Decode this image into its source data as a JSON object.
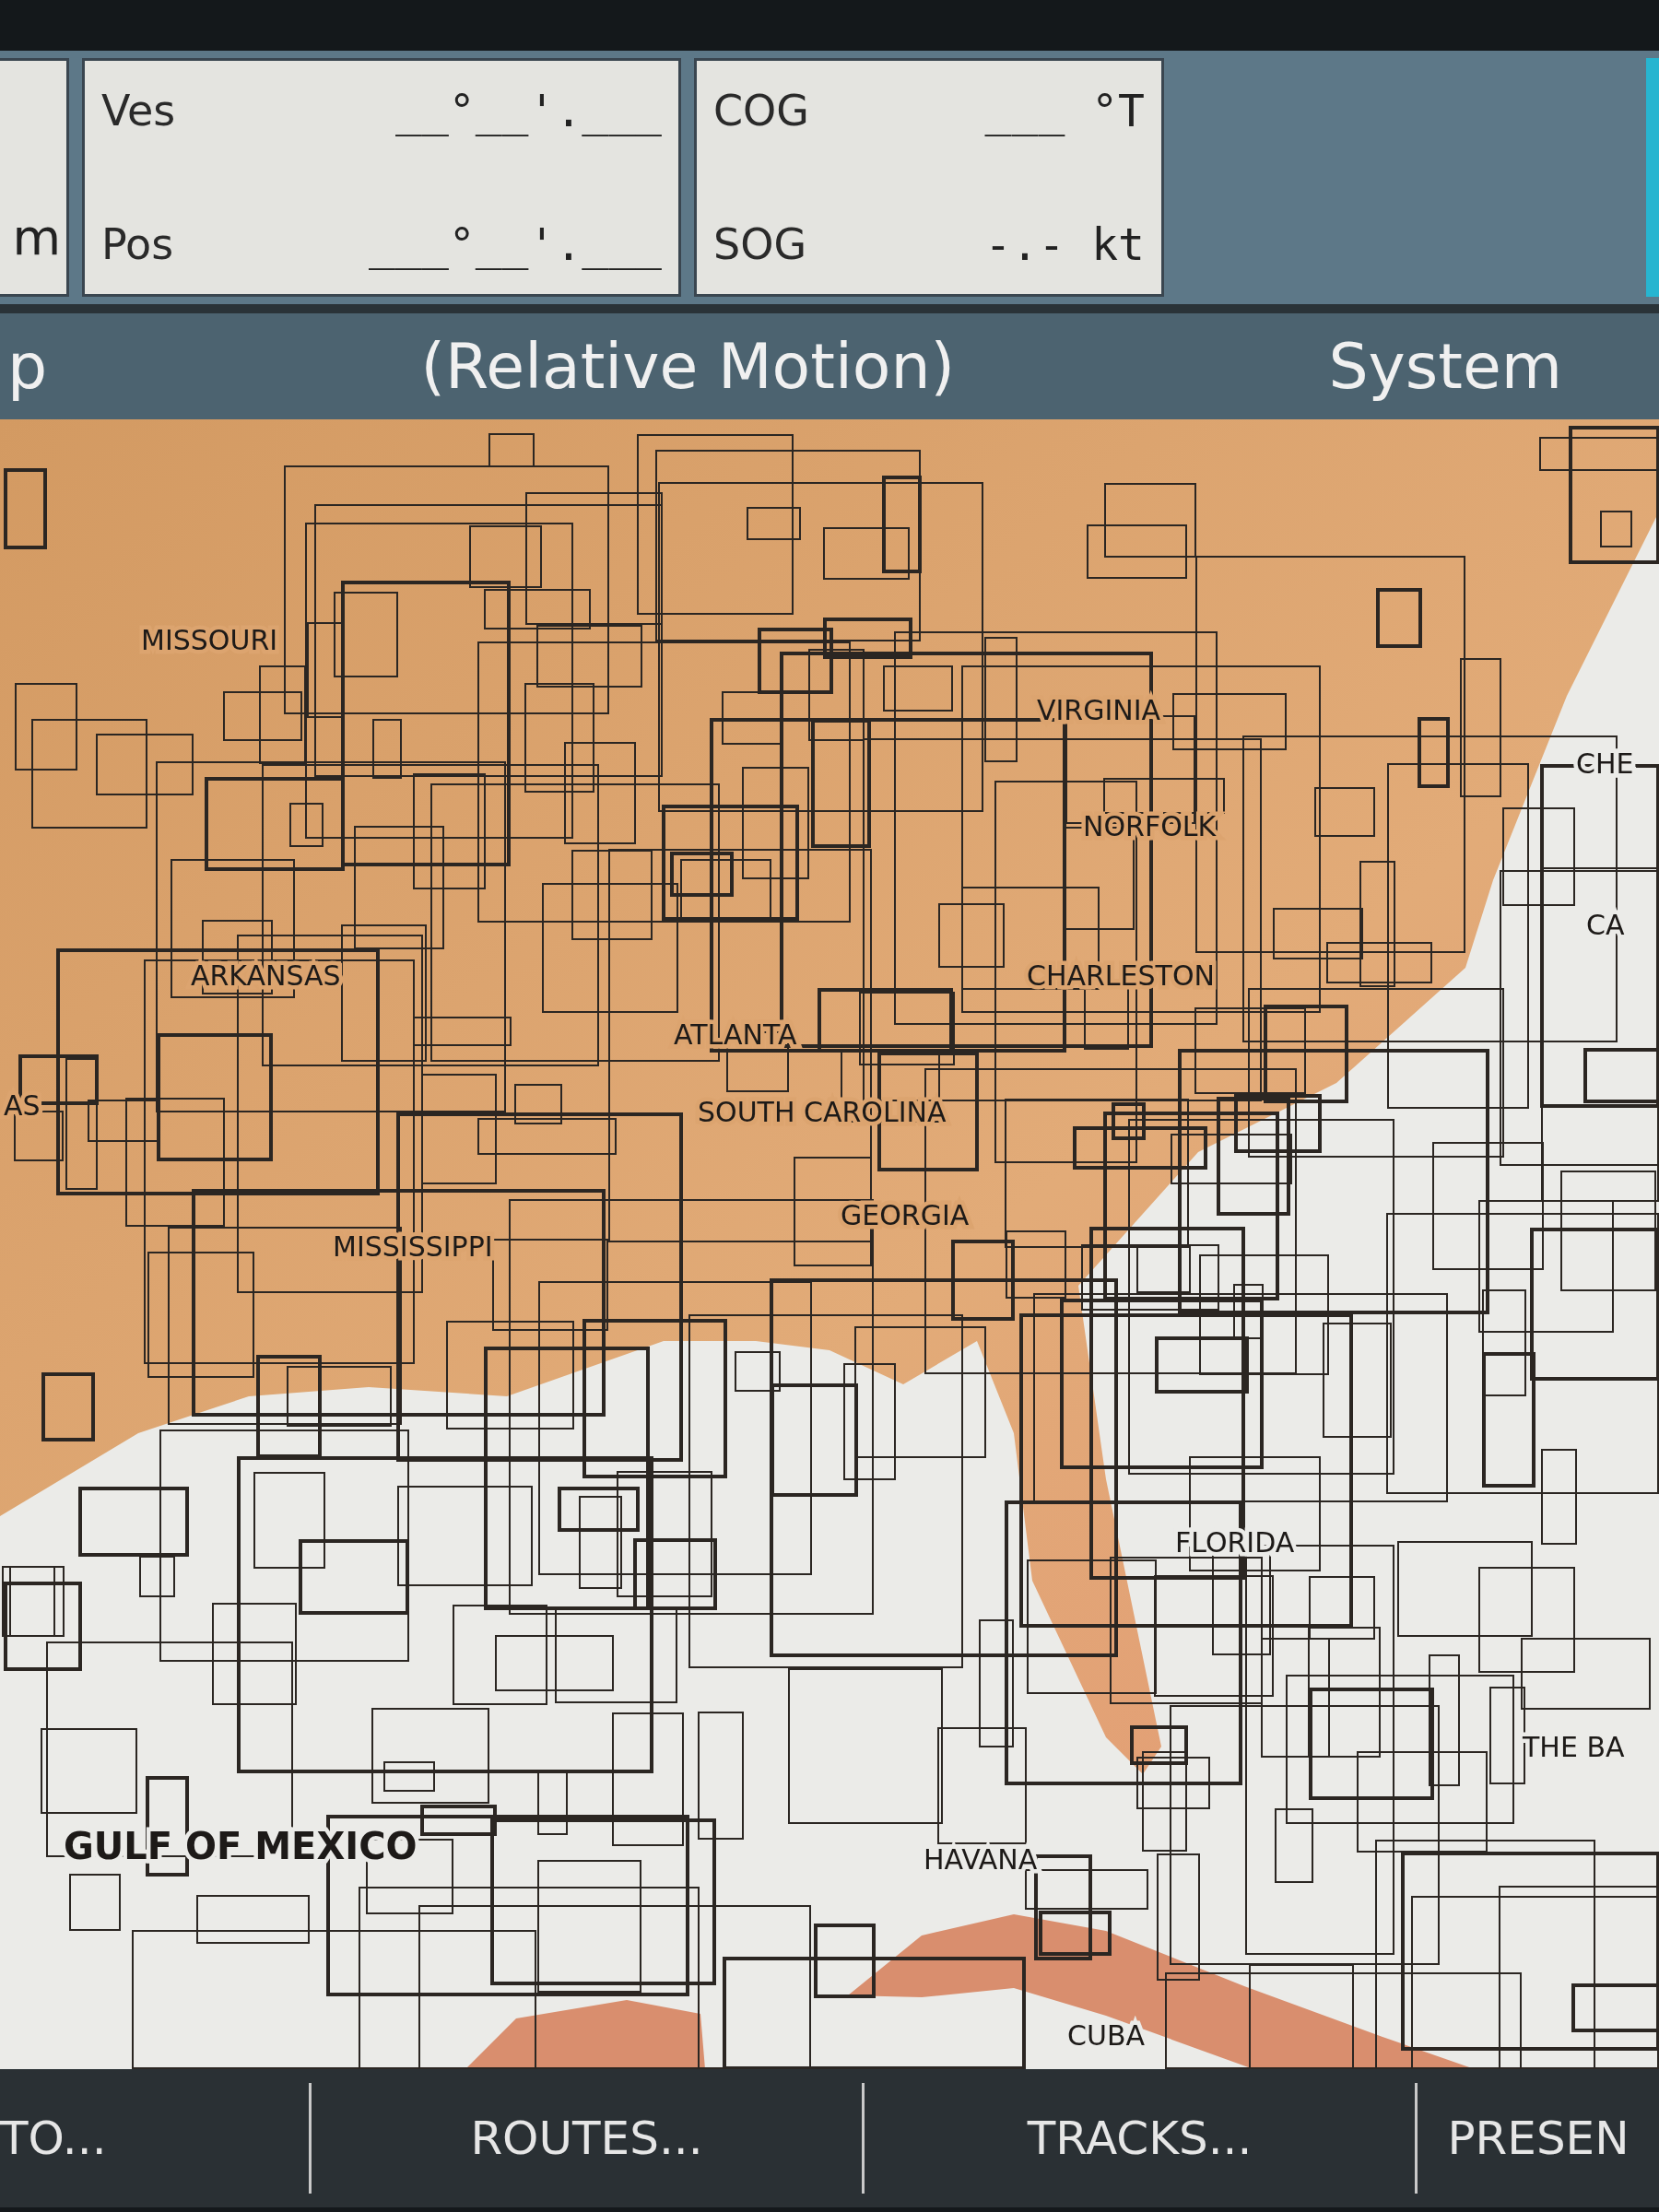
{
  "data_box_cut": {
    "text": "m"
  },
  "data_boxes": [
    {
      "fields": [
        {
          "label": "Ves",
          "value": "__°__'.___"
        },
        {
          "label": "Pos",
          "value": "___°__'.___"
        }
      ]
    },
    {
      "fields": [
        {
          "label": "COG",
          "value": "___ °T"
        },
        {
          "label": "SOG",
          "value": "-.- kt"
        }
      ]
    }
  ],
  "title_bar": {
    "left": "p",
    "center": "(Relative Motion)",
    "right": "System"
  },
  "map": {
    "labels": [
      {
        "text": "MISSOURI",
        "kind": "land"
      },
      {
        "text": "VIRGINIA",
        "kind": "land"
      },
      {
        "text": "CHE",
        "kind": "water"
      },
      {
        "text": "NORFOLK",
        "kind": "land"
      },
      {
        "text": "CA",
        "kind": "water"
      },
      {
        "text": "ARKANSAS",
        "kind": "land"
      },
      {
        "text": "CHARLESTON",
        "kind": "land"
      },
      {
        "text": "ATLANTA",
        "kind": "land"
      },
      {
        "text": "AS",
        "kind": "land"
      },
      {
        "text": "SOUTH CAROLINA",
        "kind": "land"
      },
      {
        "text": "GEORGIA",
        "kind": "land"
      },
      {
        "text": "MISSISSIPPI",
        "kind": "land"
      },
      {
        "text": "FLORIDA",
        "kind": "water"
      },
      {
        "text": "THE BA",
        "kind": "water"
      },
      {
        "text": "GULF OF MEXICO",
        "kind": "sea"
      },
      {
        "text": "HAVANA",
        "kind": "water"
      },
      {
        "text": "CUBA",
        "kind": "water"
      }
    ]
  },
  "softkeys": [
    "TO...",
    "ROUTES...",
    "TRACKS...",
    "PRESEN"
  ]
}
